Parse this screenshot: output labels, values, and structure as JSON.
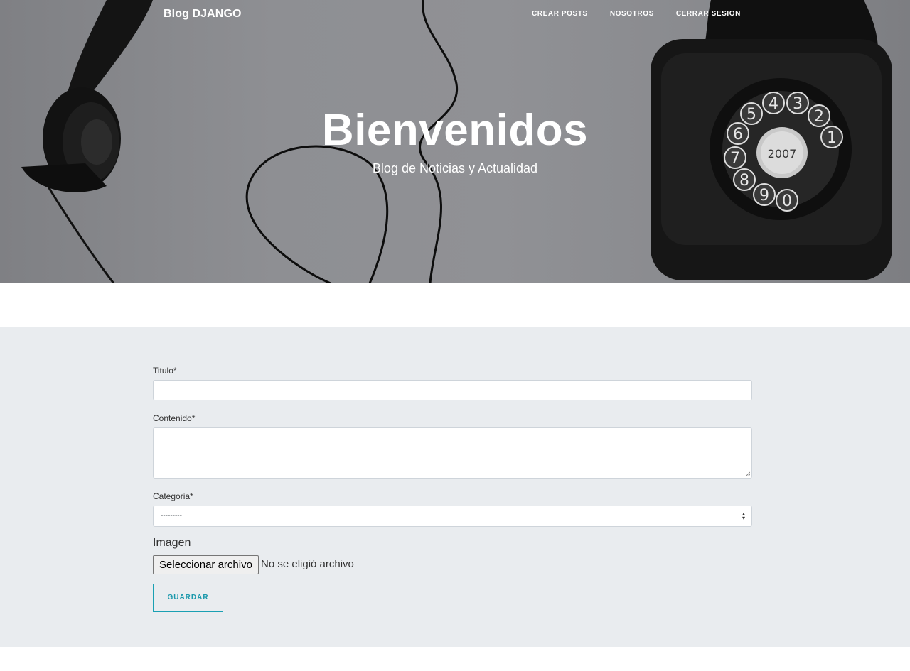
{
  "nav": {
    "brand": "Blog DJANGO",
    "links": [
      "CREAR POSTS",
      "NOSOTROS",
      "CERRAR SESION"
    ]
  },
  "hero": {
    "title": "Bienvenidos",
    "subtitle": "Blog de Noticias y Actualidad",
    "phone_dial_digits": [
      "5",
      "4",
      "3",
      "2",
      "1",
      "6",
      "7",
      "8",
      "9",
      "0"
    ],
    "phone_label": "2007",
    "icons": [
      "telephone-handset-icon",
      "rotary-phone-icon"
    ]
  },
  "form": {
    "titulo_label": "Titulo*",
    "titulo_value": "",
    "contenido_label": "Contenido*",
    "contenido_value": "",
    "categoria_label": "Categoria*",
    "categoria_selected": "---------",
    "imagen_label": "Imagen",
    "file_button": "Seleccionar archivo",
    "file_status": "No se eligió archivo",
    "save_button": "GUARDAR"
  },
  "colors": {
    "hero_gray": "#8e8f93",
    "form_bg": "#e9ecef",
    "accent": "#1aa0b3"
  }
}
